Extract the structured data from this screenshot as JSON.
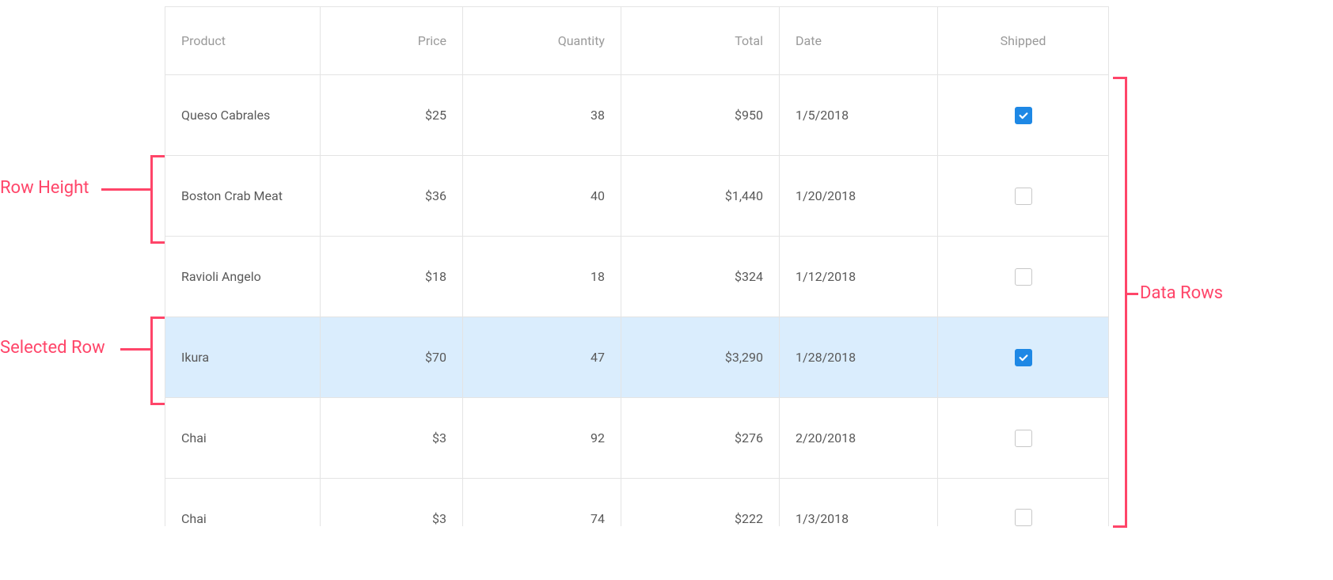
{
  "table": {
    "headers": {
      "product": "Product",
      "price": "Price",
      "quantity": "Quantity",
      "total": "Total",
      "date": "Date",
      "shipped": "Shipped"
    },
    "rows": [
      {
        "product": "Queso Cabrales",
        "price": "$25",
        "quantity": "38",
        "total": "$950",
        "date": "1/5/2018",
        "shipped": true,
        "selected": false
      },
      {
        "product": "Boston Crab Meat",
        "price": "$36",
        "quantity": "40",
        "total": "$1,440",
        "date": "1/20/2018",
        "shipped": false,
        "selected": false
      },
      {
        "product": "Ravioli Angelo",
        "price": "$18",
        "quantity": "18",
        "total": "$324",
        "date": "1/12/2018",
        "shipped": false,
        "selected": false
      },
      {
        "product": "Ikura",
        "price": "$70",
        "quantity": "47",
        "total": "$3,290",
        "date": "1/28/2018",
        "shipped": true,
        "selected": true
      },
      {
        "product": "Chai",
        "price": "$3",
        "quantity": "92",
        "total": "$276",
        "date": "2/20/2018",
        "shipped": false,
        "selected": false
      },
      {
        "product": "Chai",
        "price": "$3",
        "quantity": "74",
        "total": "$222",
        "date": "1/3/2018",
        "shipped": false,
        "selected": false
      }
    ]
  },
  "annotations": {
    "row_height": "Row Height",
    "selected_row": "Selected Row",
    "data_rows": "Data Rows"
  }
}
